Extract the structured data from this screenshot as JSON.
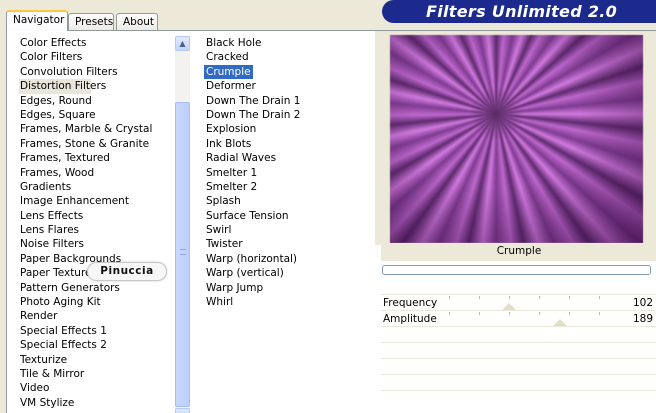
{
  "tabs": [
    {
      "label": "Navigator",
      "active": true
    },
    {
      "label": "Presets",
      "active": false
    },
    {
      "label": "About",
      "active": false
    }
  ],
  "banner": {
    "title": "Filters Unlimited 2.0"
  },
  "categories": [
    "Color Effects",
    "Color Filters",
    "Convolution Filters",
    "Distortion Filters",
    "Edges, Round",
    "Edges, Square",
    "Frames, Marble & Crystal",
    "Frames, Stone & Granite",
    "Frames, Textured",
    "Frames, Wood",
    "Gradients",
    "Image Enhancement",
    "Lens Effects",
    "Lens Flares",
    "Noise Filters",
    "Paper Backgrounds",
    "Paper Textures",
    "Pattern Generators",
    "Photo Aging Kit",
    "Render",
    "Special Effects 1",
    "Special Effects 2",
    "Texturize",
    "Tile & Mirror",
    "Video",
    "VM Stylize"
  ],
  "selected_category": "Distortion Filters",
  "filters": [
    "Black Hole",
    "Cracked",
    "Crumple",
    "Deformer",
    "Down The Drain 1",
    "Down The Drain 2",
    "Explosion",
    "Ink Blots",
    "Radial Waves",
    "Smelter 1",
    "Smelter 2",
    "Splash",
    "Surface Tension",
    "Swirl",
    "Twister",
    "Warp (horizontal)",
    "Warp (vertical)",
    "Warp Jump",
    "Whirl"
  ],
  "selected_filter": "Crumple",
  "preview": {
    "filter_name": "Crumple",
    "progress": 1.0
  },
  "sliders": [
    {
      "label": "Frequency",
      "value": "102",
      "fraction": 0.4
    },
    {
      "label": "Amplitude",
      "value": "189",
      "fraction": 0.74
    }
  ],
  "stamp": {
    "text": "Pinuccia"
  },
  "colors": {
    "selection": "#316ac5",
    "banner": "#1b2a8c",
    "progress": "#2fb94a"
  }
}
